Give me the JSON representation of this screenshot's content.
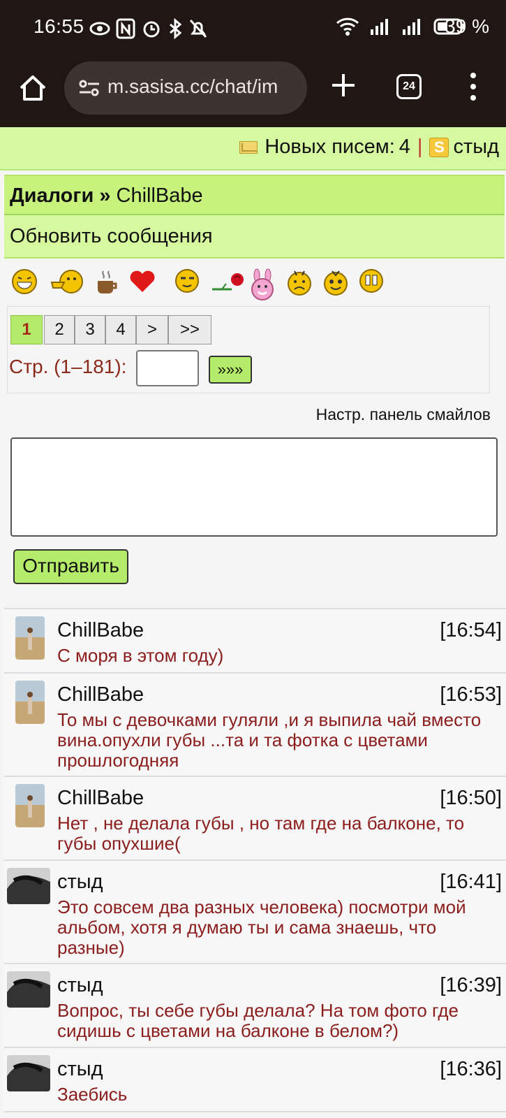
{
  "status_bar": {
    "time": "16:55",
    "battery": "39 %"
  },
  "browser": {
    "url": "m.sasisa.cc/chat/im",
    "tab_count": "24"
  },
  "notification": {
    "new_letters_label": "Новых писем:",
    "new_letters_count": "4",
    "separator": "|",
    "s_badge": "S",
    "username": "стыд"
  },
  "breadcrumb": {
    "root": "Диалоги »",
    "current": "ChillBabe"
  },
  "refresh_label": "Обновить сообщения",
  "smiles": [
    "laugh",
    "thumbs-up",
    "coffee",
    "heart",
    "wink",
    "rose",
    "bunny",
    "sad",
    "surprised",
    "worried"
  ],
  "pager": {
    "pages": [
      "1",
      "2",
      "3",
      "4",
      ">",
      ">>"
    ],
    "active_page": "1",
    "range_label": "Стр. (1–181):",
    "go_label": "»»»"
  },
  "smile_settings_label": "Настр. панель смайлов",
  "send_label": "Отправить",
  "messages": [
    {
      "author": "ChillBabe",
      "time": "[16:54]",
      "text": "С моря в этом году)"
    },
    {
      "author": "ChillBabe",
      "time": "[16:53]",
      "text": "То мы с девочками гуляли ,и я выпила чай вместо вина.опухли губы ...та и та фотка с цветами прошлогодняя"
    },
    {
      "author": "ChillBabe",
      "time": "[16:50]",
      "text": "Нет , не делала губы , но там где на балконе, то губы опухшие("
    },
    {
      "author": "стыд",
      "time": "[16:41]",
      "text": "Это совсем два разных человека) посмотри мой альбом, хотя я думаю ты и сама знаешь, что разные)"
    },
    {
      "author": "стыд",
      "time": "[16:39]",
      "text": "Вопрос, ты себе губы делала? На том фото где сидишь с цветами на балконе в белом?)"
    },
    {
      "author": "стыд",
      "time": "[16:36]",
      "text": "Заебись"
    }
  ]
}
